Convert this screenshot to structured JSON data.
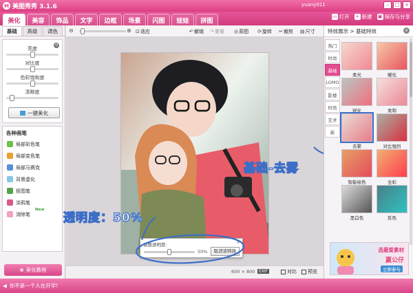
{
  "app": {
    "title": "美图秀秀 3.1.6",
    "logo": "M",
    "user": "yuany011 ·"
  },
  "window": {
    "min": "–",
    "max": "□",
    "close": "×"
  },
  "menu": [
    "美化",
    "美容",
    "饰品",
    "文字",
    "边框",
    "场景",
    "闪图",
    "娃娃",
    "拼图"
  ],
  "actions": {
    "open": "打开",
    "new": "新建",
    "save": "保存与分享"
  },
  "left": {
    "tabs": [
      "基础",
      "高级",
      "调色"
    ],
    "sliders": [
      {
        "label": "亮度",
        "value": 0.5
      },
      {
        "label": "对比度",
        "value": 0.5
      },
      {
        "label": "色彩饱和度",
        "value": 0.5
      },
      {
        "label": "清晰度",
        "value": 0.1
      }
    ],
    "one_key": "一键美化",
    "brush_title": "各种画笔",
    "brushes": [
      {
        "label": "局部彩色笔",
        "color": "#6fbf4a"
      },
      {
        "label": "局部变色笔",
        "color": "#e8a030"
      },
      {
        "label": "局部马赛克",
        "color": "#5b8fd8"
      },
      {
        "label": "背景虚化",
        "color": "#88c7e8"
      },
      {
        "label": "抠图笔",
        "color": "#56a24a"
      },
      {
        "label": "涂鸦笔",
        "color": "#d65a8a"
      },
      {
        "label": "消除笔",
        "color": "#f0a0c0"
      }
    ],
    "new_badge": "New",
    "tutorial": "美化教程"
  },
  "toolbar": {
    "fit": "适应",
    "undo": "撤销",
    "redo": "重做",
    "original": "原图",
    "rotate": "旋转",
    "crop": "裁剪",
    "size": "尺寸"
  },
  "dialog": {
    "title": "调整透明度:",
    "opacity": 0.5,
    "value_label": "50%",
    "cancel": "取消该特效",
    "close": "×"
  },
  "annotations": {
    "opacity": "透明度：50%",
    "effect": "基础-去雾"
  },
  "status": {
    "dims": "600 × 800",
    "exif": "EXIF",
    "compare": "对比",
    "preview": "预览"
  },
  "right": {
    "header": "特效展示 > 基础特效",
    "categories": [
      "热门",
      "时尚",
      "基础",
      "LOMO",
      "影楼",
      "时尚",
      "艺术",
      "新"
    ],
    "active_category": 2,
    "effects": [
      "柔光",
      "暖化",
      "锐化",
      "柔和",
      "去雾",
      "对比强烈",
      "智能绘色",
      "全彩",
      "黑白色",
      "反色"
    ],
    "selected_effect": 4,
    "ad": {
      "line1": "选最爱素材",
      "line2": "赢公仔",
      "line3": "立即参与"
    }
  },
  "statusbar": {
    "message": "你不是一个人在开学!"
  }
}
